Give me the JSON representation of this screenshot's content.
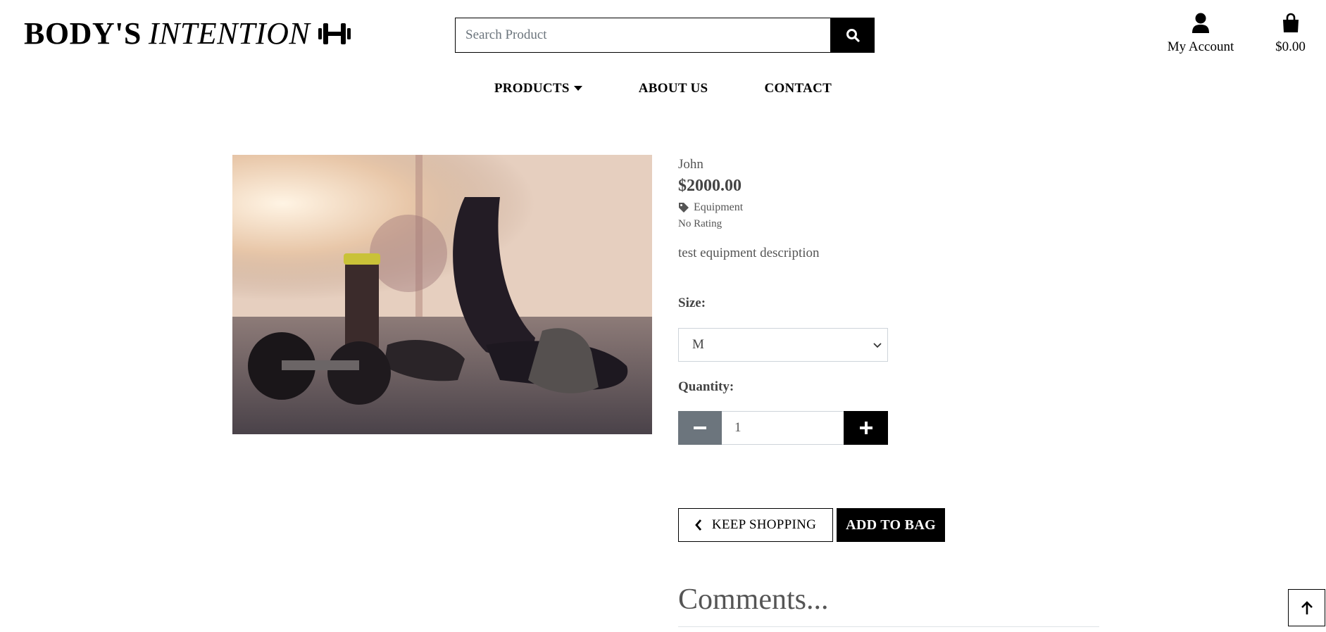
{
  "header": {
    "logo_main": "BODY'S",
    "logo_italic": "INTENTION",
    "search_placeholder": "Search Product",
    "account_label": "My Account",
    "bag_total": "$0.00"
  },
  "nav": {
    "items": [
      {
        "label": "PRODUCTS"
      },
      {
        "label": "ABOUT US"
      },
      {
        "label": "CONTACT"
      }
    ]
  },
  "product": {
    "name": "John",
    "price": "$2000.00",
    "category": "Equipment",
    "rating": "No Rating",
    "description": "test equipment description",
    "size_label": "Size:",
    "size_value": "M",
    "quantity_label": "Quantity:",
    "quantity_value": "1",
    "keep_shopping_label": "KEEP SHOPPING",
    "add_to_bag_label": "ADD TO BAG"
  },
  "comments": {
    "heading": "Comments..."
  },
  "colors": {
    "primary": "#000000",
    "muted": "#6c757d",
    "text": "#555555"
  }
}
